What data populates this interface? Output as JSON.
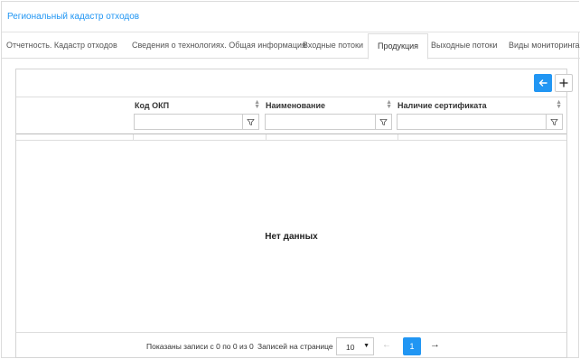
{
  "header": {
    "title": "Региональный кадастр отходов"
  },
  "tabs": [
    {
      "label": "Отчетность. Кадастр отходов",
      "active": false
    },
    {
      "label": "Сведения о технологиях. Общая информация",
      "active": false
    },
    {
      "label": "Входные потоки",
      "active": false
    },
    {
      "label": "Продукция",
      "active": true
    },
    {
      "label": "Выходные потоки",
      "active": false
    },
    {
      "label": "Виды мониторинга",
      "active": false
    }
  ],
  "toolbar": {
    "back_icon": "arrow-left-icon",
    "add_icon": "plus-icon"
  },
  "grid": {
    "columns": [
      {
        "label": "Код ОКП",
        "filter_value": ""
      },
      {
        "label": "Наименование",
        "filter_value": ""
      },
      {
        "label": "Наличие сертификата",
        "filter_value": ""
      }
    ],
    "empty_text": "Нет данных"
  },
  "footer": {
    "records_info": "Показаны записи с 0 по 0 из 0",
    "per_page_label": "Записей на странице",
    "page_size": "10",
    "current_page": "1"
  },
  "colors": {
    "accent": "#2196f3",
    "border": "#d4d4d4"
  }
}
